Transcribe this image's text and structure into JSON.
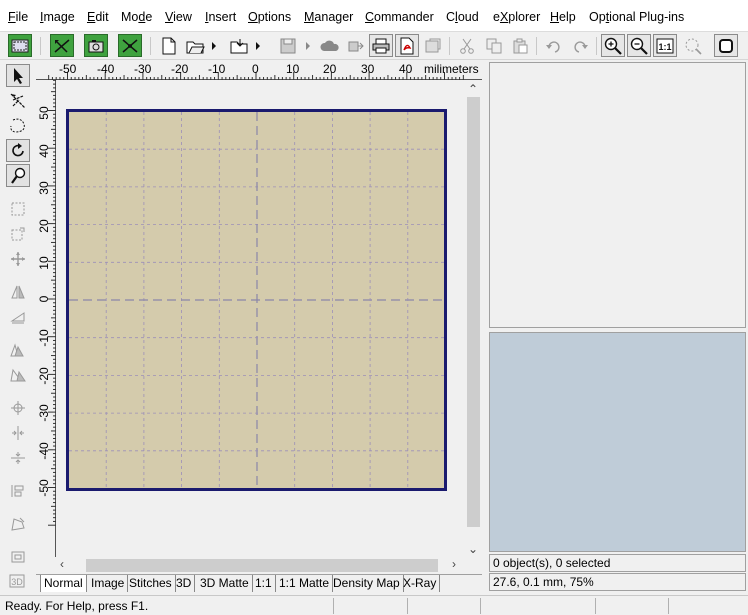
{
  "menu": [
    {
      "label": "File",
      "pre": "",
      "u": "F",
      "post": "ile"
    },
    {
      "label": "Image",
      "pre": "",
      "u": "I",
      "post": "mage"
    },
    {
      "label": "Edit",
      "pre": "",
      "u": "E",
      "post": "dit"
    },
    {
      "label": "Mode",
      "pre": "Mo",
      "u": "d",
      "post": "e"
    },
    {
      "label": "View",
      "pre": "",
      "u": "V",
      "post": "iew"
    },
    {
      "label": "Insert",
      "pre": "",
      "u": "I",
      "post": "nsert"
    },
    {
      "label": "Options",
      "pre": "",
      "u": "O",
      "post": "ptions"
    },
    {
      "label": "Manager",
      "pre": "",
      "u": "M",
      "post": "anager"
    },
    {
      "label": "Commander",
      "pre": "",
      "u": "C",
      "post": "ommander"
    },
    {
      "label": "Cloud",
      "pre": "C",
      "u": "l",
      "post": "oud"
    },
    {
      "label": "eXplorer",
      "pre": "e",
      "u": "X",
      "post": "plorer"
    },
    {
      "label": "Help",
      "pre": "",
      "u": "H",
      "post": "elp"
    },
    {
      "label": "Optional Plug-ins",
      "pre": "Op",
      "u": "t",
      "post": "ional Plug-ins"
    }
  ],
  "ruler": {
    "unit_label": "milimeters",
    "h_ticks": [
      "-50",
      "-40",
      "-30",
      "-20",
      "-10",
      "0",
      "10",
      "20",
      "30",
      "40"
    ],
    "v_ticks": [
      "50",
      "40",
      "30",
      "20",
      "10",
      "0",
      "-10",
      "-20",
      "-30",
      "-40",
      "-50"
    ]
  },
  "tabs": [
    "Normal",
    "Image",
    "Stitches",
    "3D",
    "3D Matte",
    "1:1",
    "1:1 Matte",
    "Density Map",
    "X-Ray"
  ],
  "active_tab": "Normal",
  "right_pane": {
    "selection_status": "0 object(s), 0 selected",
    "coords_status": "27.6, 0.1 mm, 75%"
  },
  "status_bar": {
    "message": "Ready. For Help, press F1."
  },
  "colors": {
    "hoop_fill": "#d4cbac",
    "hoop_border": "#1a1a6e",
    "grid_line": "#9c8fb8",
    "preview_bg": "#bfccd8"
  }
}
